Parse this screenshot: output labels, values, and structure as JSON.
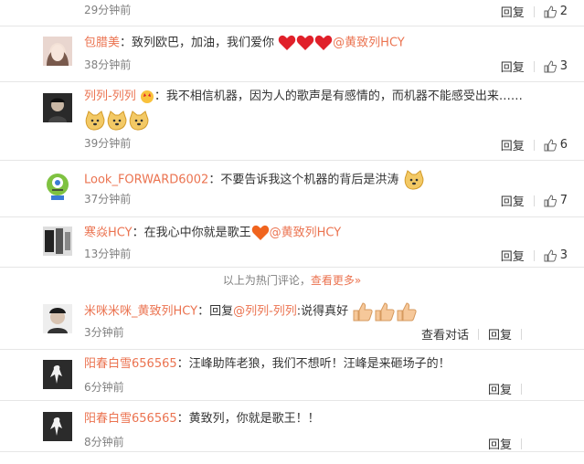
{
  "comments": [
    {
      "time": "29分钟前",
      "reply": "回复",
      "likes": "2"
    },
    {
      "user": "包腊美",
      "text": "：致列欧巴，加油，我们爱你",
      "mention": "@黄致列HCY",
      "time": "38分钟前",
      "reply": "回复",
      "likes": "3"
    },
    {
      "user": "列列-列列",
      "text": "：我不相信机器，因为人的歌声是有感情的，而机器不能感受出来……",
      "time": "39分钟前",
      "reply": "回复",
      "likes": "6"
    },
    {
      "user": "Look_FORWARD6002",
      "text": "：不要告诉我这个机器的背后是洪涛",
      "time": "37分钟前",
      "reply": "回复",
      "likes": "7"
    },
    {
      "user": "寒焱HCY",
      "text": "：在我心中你就是歌王",
      "mention": "@黄致列HCY",
      "time": "13分钟前",
      "reply": "回复",
      "likes": "3"
    },
    {
      "user": "米咪米咪_黄致列HCY",
      "text": "：回复",
      "mention": "@列列-列列",
      "text2": ":说得真好",
      "time": "3分钟前",
      "view_conversation": "查看对话",
      "reply": "回复"
    },
    {
      "user": "阳春白雪656565",
      "text": "：汪峰助阵老狼，我们不想听！汪峰是来砸场子的！",
      "time": "6分钟前",
      "reply": "回复"
    },
    {
      "user": "阳春白雪656565",
      "text": "：黄致列，你就是歌王！！",
      "time": "8分钟前",
      "reply": "回复"
    }
  ],
  "hot": {
    "prefix": "以上为热门评论，",
    "more": "查看更多»"
  },
  "colors": {
    "link": "#eb7350",
    "heart": "#e0202a",
    "muted": "#808080"
  }
}
